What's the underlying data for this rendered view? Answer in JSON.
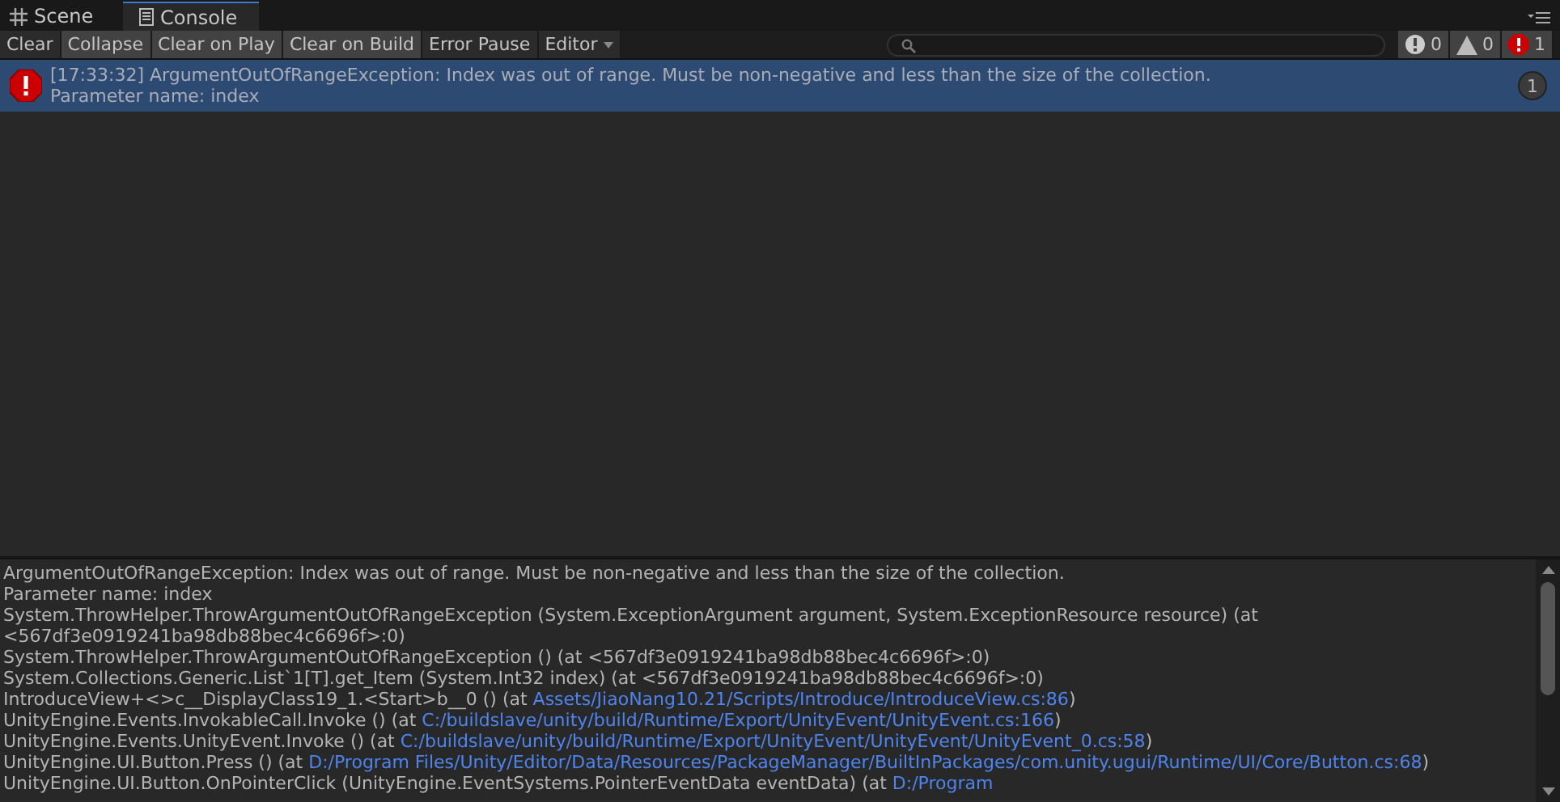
{
  "tabs": [
    {
      "label": "Scene",
      "selected": false
    },
    {
      "label": "Console",
      "selected": true
    }
  ],
  "toolbar": {
    "buttons": [
      {
        "label": "Clear",
        "kind": "button",
        "selected": false
      },
      {
        "label": "Collapse",
        "kind": "toggle",
        "selected": true
      },
      {
        "label": "Clear on Play",
        "kind": "toggle",
        "selected": true
      },
      {
        "label": "Clear on Build",
        "kind": "toggle",
        "selected": true
      },
      {
        "label": "Error Pause",
        "kind": "toggle",
        "selected": false
      },
      {
        "label": "Editor",
        "kind": "dropdown",
        "selected": false
      }
    ],
    "counters": [
      {
        "kind": "info",
        "count": "0",
        "selected": true
      },
      {
        "kind": "warning",
        "count": "0",
        "selected": true
      },
      {
        "kind": "error",
        "count": "1",
        "selected": true
      }
    ]
  },
  "log_entries": [
    {
      "kind": "error",
      "selected": true,
      "lines": [
        "[17:33:32] ArgumentOutOfRangeException: Index was out of range. Must be non-negative and less than the size of the collection.",
        "Parameter name: index"
      ],
      "count": "1"
    }
  ],
  "details": [
    {
      "text": "ArgumentOutOfRangeException: Index was out of range. Must be non-negative and less than the size of the collection."
    },
    {
      "text": "Parameter name: index"
    },
    {
      "text": "System.ThrowHelper.ThrowArgumentOutOfRangeException (System.ExceptionArgument argument, System.ExceptionResource resource) (at"
    },
    {
      "text": "<567df3e0919241ba98db88bec4c6696f>:0)"
    },
    {
      "text": "System.ThrowHelper.ThrowArgumentOutOfRangeException () (at <567df3e0919241ba98db88bec4c6696f>:0)"
    },
    {
      "text": "System.Collections.Generic.List`1[T].get_Item (System.Int32 index) (at <567df3e0919241ba98db88bec4c6696f>:0)"
    },
    {
      "text": "IntroduceView+<>c__DisplayClass19_1.<Start>b__0 () (at ",
      "link": "Assets/JiaoNang10.21/Scripts/Introduce/IntroduceView.cs:86",
      "after": ")"
    },
    {
      "text": "UnityEngine.Events.InvokableCall.Invoke () (at ",
      "link": "C:/buildslave/unity/build/Runtime/Export/UnityEvent/UnityEvent.cs:166",
      "after": ")"
    },
    {
      "text": "UnityEngine.Events.UnityEvent.Invoke () (at ",
      "link": "C:/buildslave/unity/build/Runtime/Export/UnityEvent/UnityEvent/UnityEvent_0.cs:58",
      "after": ")"
    },
    {
      "text": "UnityEngine.UI.Button.Press () (at ",
      "link": "D:/Program Files/Unity/Editor/Data/Resources/PackageManager/BuiltInPackages/com.unity.ugui/Runtime/UI/Core/Button.cs:68",
      "after": ")"
    },
    {
      "text": "UnityEngine.UI.Button.OnPointerClick (UnityEngine.EventSystems.PointerEventData eventData) (at ",
      "link": "D:/Program"
    }
  ]
}
